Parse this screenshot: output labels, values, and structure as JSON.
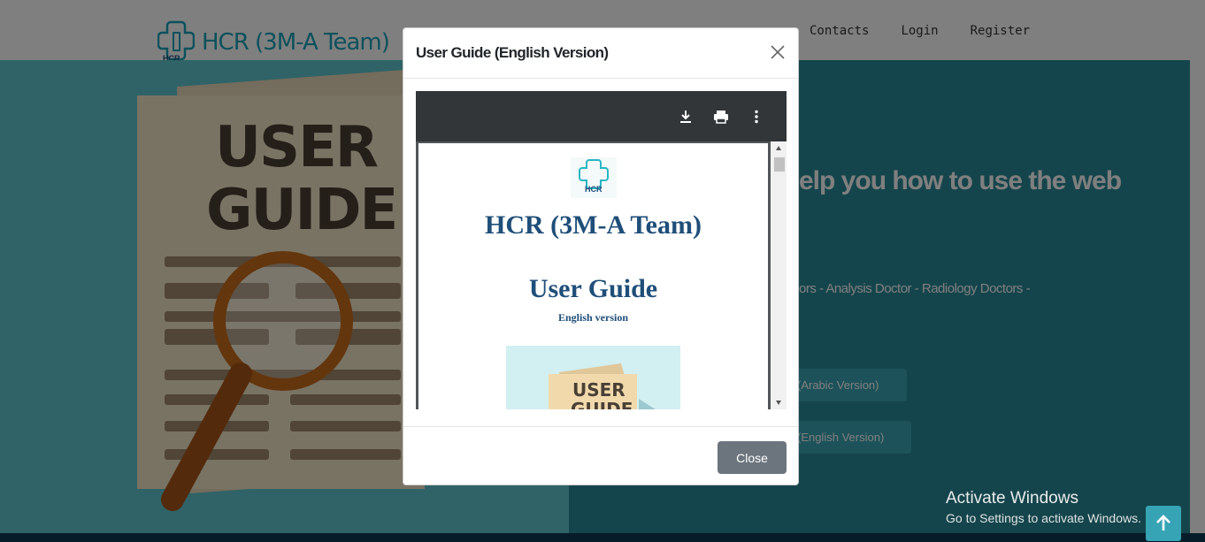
{
  "navbar": {
    "brand": "HCR (3M-A Team)",
    "logo_text": "HCR",
    "links": [
      "Contacts",
      "Login",
      "Register"
    ]
  },
  "hero": {
    "image_text_line1": "USER",
    "image_text_line2": "GUIDE",
    "heading_fragment": "elp you how to use the web",
    "doctors_fragment": "ors - Analysis Doctor - Radiology Doctors -",
    "button_arabic": "(Arabic Version)",
    "button_english": "(English Version)"
  },
  "modal": {
    "title": "User Guide (English Version)",
    "close_label": "Close"
  },
  "pdf": {
    "doc_title": "HCR (3M-A Team)",
    "doc_subtitle": "User Guide",
    "doc_language": "English version",
    "image_text_line1": "USER",
    "image_text_line2": "GUIDE"
  },
  "os_watermark": {
    "title": "Activate Windows",
    "subtitle": "Go to Settings to activate Windows."
  },
  "colors": {
    "brand": "#17a2b8",
    "hero": "#2b8b99",
    "pdf_toolbar": "#323639",
    "close_button": "#6c757d"
  }
}
